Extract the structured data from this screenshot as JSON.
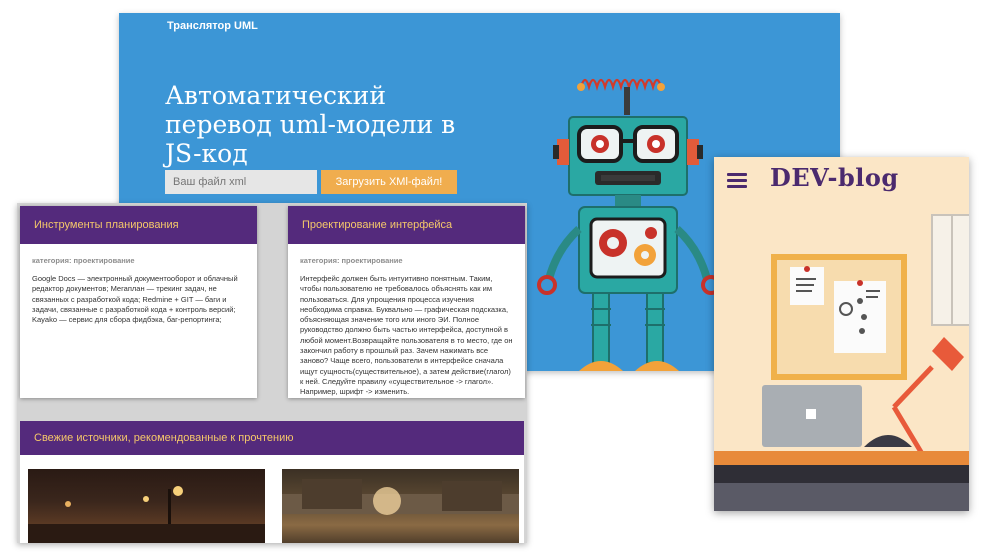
{
  "uml_panel": {
    "brand": "Транслятор UML",
    "headline": "Автоматический перевод uml-модели в JS-код",
    "file_placeholder": "Ваш файл xml",
    "upload_label": "Загрузить XMl-файл!"
  },
  "cards_panel": {
    "cards": [
      {
        "title": "Инструменты планирования",
        "category": "категория: проектирование",
        "text": "Google Docs — электронный документооборот и облачный редактор документов; Мегаплан — трекинг задач, не связанных с разработкой кода; Redmine + GIT — баги и задачи, связанные с разработкой кода + контроль версий; Kayako — сервис для сбора фидбэка, баг-репортинга;"
      },
      {
        "title": "Проектирование интерфейса",
        "category": "категория: проектирование",
        "text": "Интерфейс должен быть интуитивно понятным. Таким, чтобы пользователю не требовалось объяснять как им пользоваться. Для упрощения процесса изучения необходима справка. Буквально — графическая подсказка, объясняющая значение того или иного ЭИ. Полное руководство должно быть частью интерфейса, доступной в любой момент.Возвращайте пользователя в то место, где он закончил работу в прошлый раз. Зачем нажимать все заново? Чаще всего, пользователи в интерфейсе сначала ищут сущность(существительное), а затем действие(глагол) к ней. Следуйте правилу «существительное -> глагол». Например, шрифт -> изменить."
      }
    ],
    "sources_title": "Свежие источники, рекомендованные к прочтению"
  },
  "devblog_panel": {
    "logo": "DEV-blog"
  },
  "colors": {
    "uml_bg": "#3c96d6",
    "accent_orange": "#f0ad4e",
    "purple": "#542a7c",
    "card_title": "#f5c86a",
    "devblog_bg": "#fbe6c6"
  },
  "icons": [
    "robot-illustration",
    "hamburger-menu-icon",
    "desk-lamp-illustration",
    "laptop-illustration"
  ]
}
